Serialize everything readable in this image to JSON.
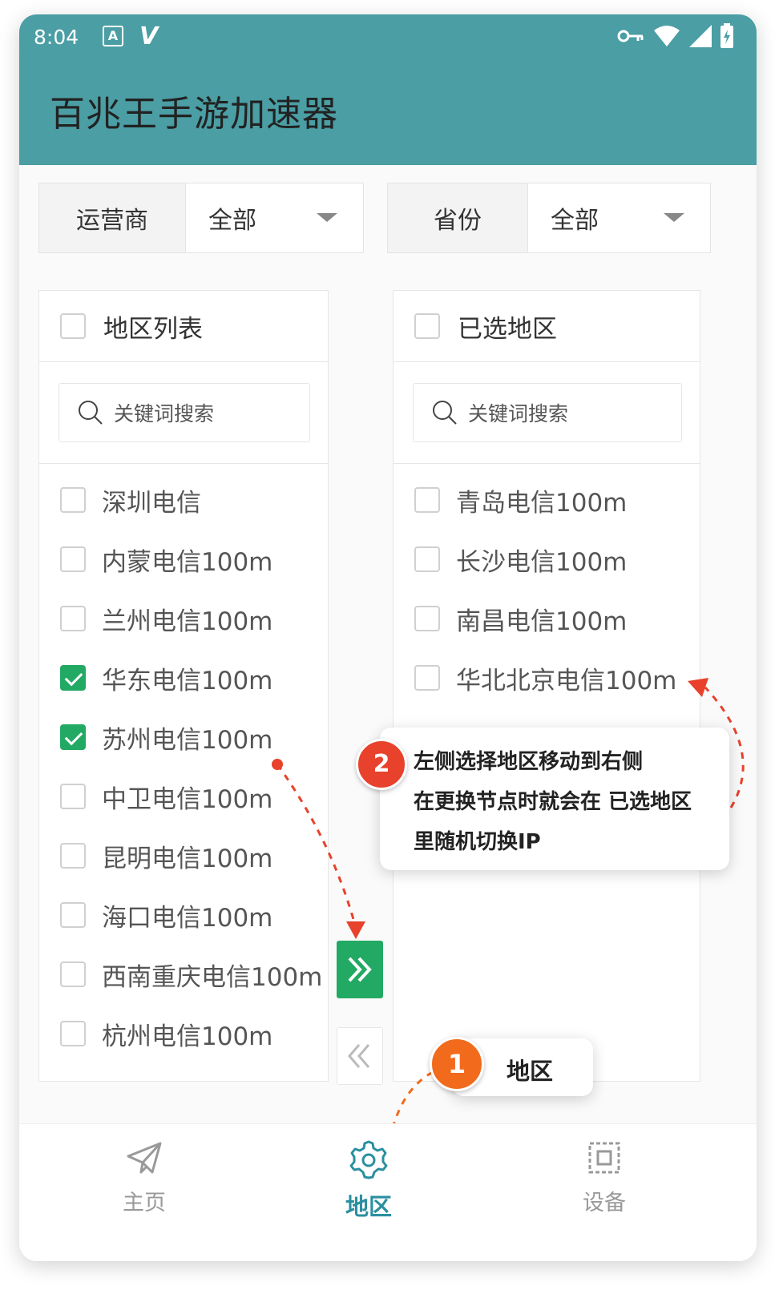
{
  "status_bar": {
    "time": "8:04",
    "a_badge": "A",
    "v_badge": "V"
  },
  "app": {
    "title": "百兆王手游加速器"
  },
  "filters": {
    "carrier": {
      "label": "运营商",
      "value": "全部"
    },
    "province": {
      "label": "省份",
      "value": "全部"
    }
  },
  "left_panel": {
    "title": "地区列表",
    "search_placeholder": "关键词搜索",
    "items": [
      {
        "label": "深圳电信",
        "checked": false
      },
      {
        "label": "内蒙电信100m",
        "checked": false
      },
      {
        "label": "兰州电信100m",
        "checked": false
      },
      {
        "label": "华东电信100m",
        "checked": true
      },
      {
        "label": "苏州电信100m",
        "checked": true
      },
      {
        "label": "中卫电信100m",
        "checked": false
      },
      {
        "label": "昆明电信100m",
        "checked": false
      },
      {
        "label": "海口电信100m",
        "checked": false
      },
      {
        "label": "西南重庆电信100m",
        "checked": false
      },
      {
        "label": "杭州电信100m",
        "checked": false
      }
    ]
  },
  "right_panel": {
    "title": "已选地区",
    "search_placeholder": "关键词搜索",
    "items": [
      {
        "label": "青岛电信100m",
        "checked": false
      },
      {
        "label": "长沙电信100m",
        "checked": false
      },
      {
        "label": "南昌电信100m",
        "checked": false
      },
      {
        "label": "华北北京电信100m",
        "checked": false
      }
    ]
  },
  "transfer_buttons": {
    "move_right": "»",
    "move_left": "«"
  },
  "callouts": {
    "step1": {
      "number": "1",
      "text": "地区"
    },
    "step2": {
      "number": "2",
      "lines": [
        "左侧选择地区移动到右侧",
        "在更换节点时就会在 已选地区",
        "里随机切换IP"
      ]
    }
  },
  "tabbar": {
    "tabs": [
      {
        "label": "主页",
        "icon": "paper-plane-icon",
        "active": false
      },
      {
        "label": "地区",
        "icon": "gear-icon",
        "active": true
      },
      {
        "label": "设备",
        "icon": "chip-icon",
        "active": false
      }
    ]
  },
  "colors": {
    "appbar": "#4a9ea4",
    "check": "#22a963",
    "active_tab": "#2a8fa0",
    "inactive_tab": "#999999",
    "callout_red": "#e8412c",
    "callout_orange": "#f26a1b"
  }
}
